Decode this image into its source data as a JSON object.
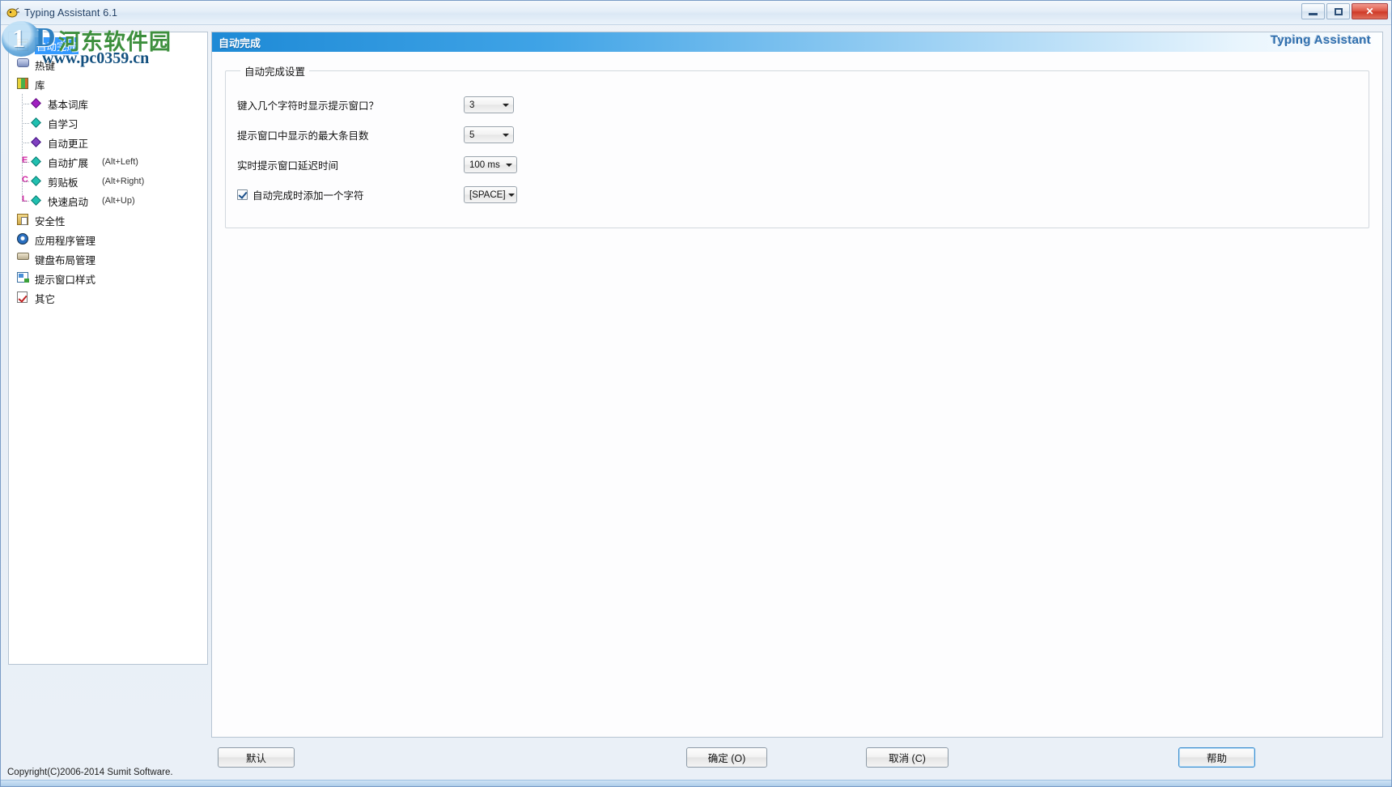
{
  "window": {
    "title": "Typing Assistant 6.1",
    "icon": "app-icon",
    "controls": {
      "minimize": "minimize-icon",
      "maximize": "maximize-icon",
      "close": "✕"
    }
  },
  "watermark": {
    "logo_digit": "1",
    "logo_letter": "D",
    "site_name": "河东软件园",
    "url": "www.pc0359.cn"
  },
  "tree": {
    "items": [
      {
        "label": "自动完成",
        "icon": "document-icon",
        "level": 0,
        "selected": true,
        "shortcut": "",
        "prefix": ""
      },
      {
        "label": "热键",
        "icon": "key-icon",
        "level": 0,
        "selected": false,
        "shortcut": "",
        "prefix": ""
      },
      {
        "label": "库",
        "icon": "books-icon",
        "level": 0,
        "selected": false,
        "shortcut": "",
        "prefix": ""
      },
      {
        "label": "基本词库",
        "icon": "diamond-purple-icon",
        "level": 1,
        "selected": false,
        "shortcut": "",
        "prefix": ""
      },
      {
        "label": "自学习",
        "icon": "diamond-teal-icon",
        "level": 1,
        "selected": false,
        "shortcut": "",
        "prefix": ""
      },
      {
        "label": "自动更正",
        "icon": "diamond-violet-icon",
        "level": 1,
        "selected": false,
        "shortcut": "",
        "prefix": ""
      },
      {
        "label": "自动扩展",
        "icon": "diamond-teal-icon",
        "level": 1,
        "selected": false,
        "shortcut": "(Alt+Left)",
        "prefix": "E"
      },
      {
        "label": "剪贴板",
        "icon": "diamond-teal-icon",
        "level": 1,
        "selected": false,
        "shortcut": "(Alt+Right)",
        "prefix": "C"
      },
      {
        "label": "快速启动",
        "icon": "diamond-teal-icon",
        "level": 1,
        "selected": false,
        "shortcut": "(Alt+Up)",
        "prefix": "L"
      },
      {
        "label": "安全性",
        "icon": "lock-icon",
        "level": 0,
        "selected": false,
        "shortcut": "",
        "prefix": ""
      },
      {
        "label": "应用程序管理",
        "icon": "app-manager-icon",
        "level": 0,
        "selected": false,
        "shortcut": "",
        "prefix": ""
      },
      {
        "label": "键盘布局管理",
        "icon": "keyboard-icon",
        "level": 0,
        "selected": false,
        "shortcut": "",
        "prefix": ""
      },
      {
        "label": "提示窗口样式",
        "icon": "window-style-icon",
        "level": 0,
        "selected": false,
        "shortcut": "",
        "prefix": ""
      },
      {
        "label": "其它",
        "icon": "checklist-icon",
        "level": 0,
        "selected": false,
        "shortcut": "",
        "prefix": ""
      }
    ]
  },
  "page": {
    "header_title": "自动完成",
    "brand": "Typing Assistant",
    "group_title": "自动完成设置",
    "rows": [
      {
        "label": "键入几个字符时显示提示窗口？",
        "value": "3",
        "has_checkbox": false,
        "checked": false
      },
      {
        "label": "提示窗口中显示的最大条目数",
        "value": "5",
        "has_checkbox": false,
        "checked": false
      },
      {
        "label": "实时提示窗口延迟时间",
        "value": "100 ms",
        "has_checkbox": false,
        "checked": false
      },
      {
        "label": "自动完成时添加一个字符",
        "value": "[SPACE]",
        "has_checkbox": true,
        "checked": true
      }
    ]
  },
  "footer": {
    "default_label": "默认",
    "ok_label": "确定 (O)",
    "cancel_label": "取消 (C)",
    "help_label": "帮助",
    "copyright": "Copyright(C)2006-2014  Sumit Software."
  },
  "colors": {
    "accent": "#1e8ad6",
    "brand_text": "#2f6fae",
    "selection": "#3399ff",
    "close_button": "#cf3a28"
  }
}
